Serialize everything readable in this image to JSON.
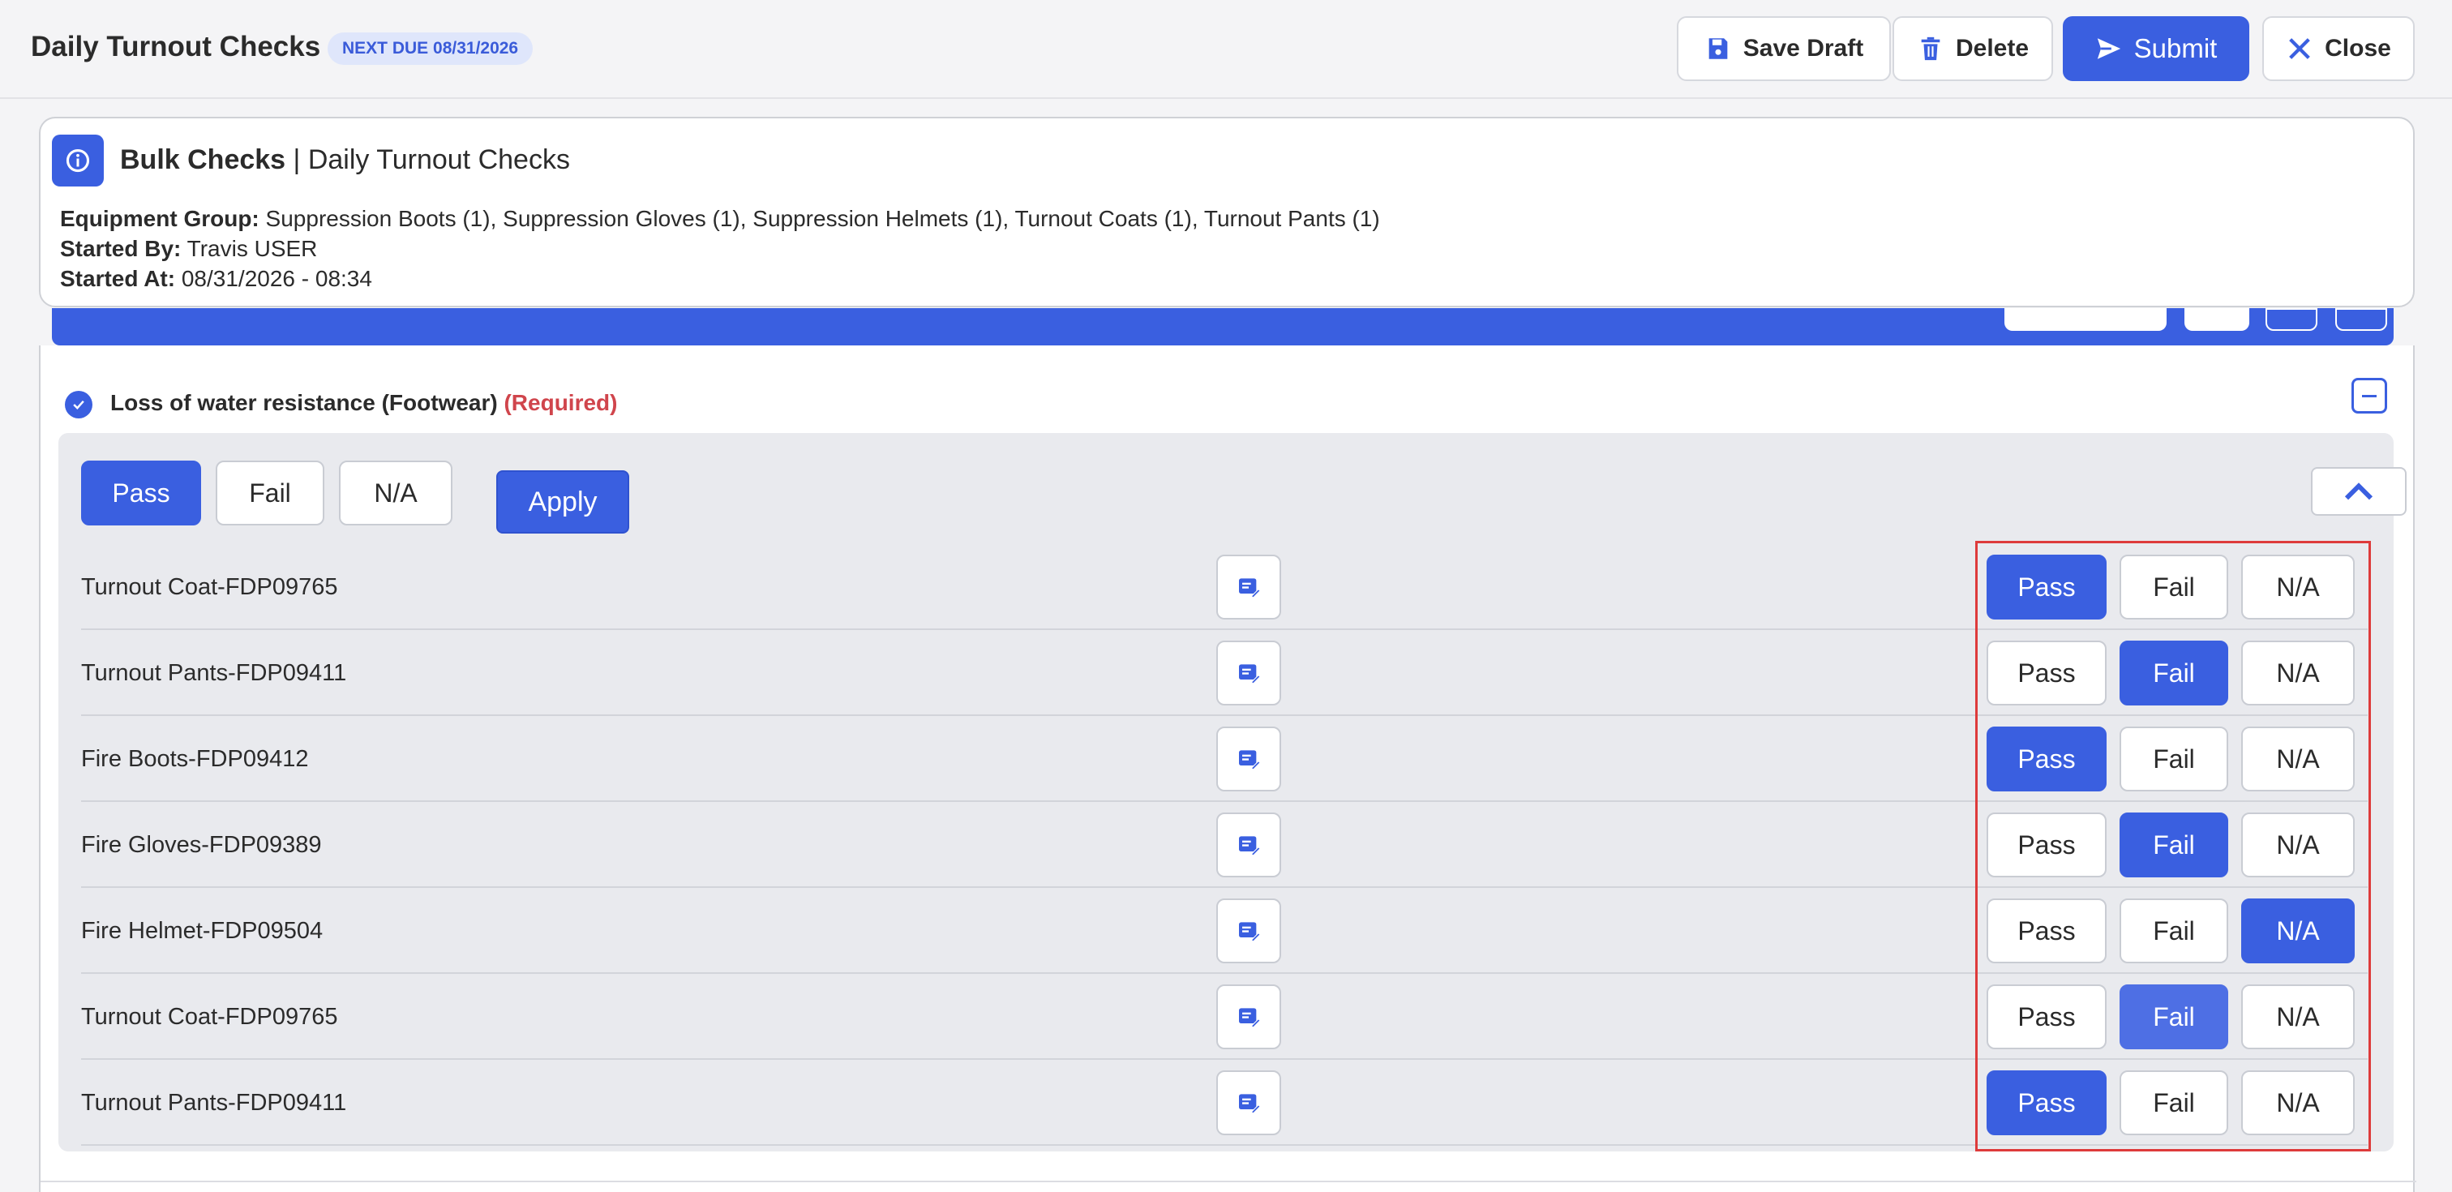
{
  "header": {
    "title": "Daily Turnout Checks",
    "due_badge": "NEXT DUE 08/31/2026",
    "buttons": {
      "save_draft": "Save Draft",
      "delete": "Delete",
      "submit": "Submit",
      "close": "Close"
    }
  },
  "info": {
    "title_bold": "Bulk Checks",
    "title_rest": " | Daily Turnout Checks",
    "equipment_label": "Equipment Group:",
    "equipment_value": " Suppression Boots (1), Suppression Gloves (1), Suppression Helmets (1), Turnout Coats (1), Turnout Pants (1)",
    "started_by_label": "Started By:",
    "started_by_value": " Travis USER",
    "started_at_label": "Started At:",
    "started_at_value": " 08/31/2026 - 08:34"
  },
  "question": {
    "text": "Loss of water resistance (Footwear)",
    "required": "(Required)"
  },
  "bulk": {
    "pass": "Pass",
    "fail": "Fail",
    "na": "N/A",
    "selected": "Pass",
    "apply": "Apply"
  },
  "rows": [
    {
      "label": "Turnout Coat-FDP09765",
      "selected": "Pass"
    },
    {
      "label": "Turnout Pants-FDP09411",
      "selected": "Fail"
    },
    {
      "label": "Fire Boots-FDP09412",
      "selected": "Pass"
    },
    {
      "label": "Fire Gloves-FDP09389",
      "selected": "Fail"
    },
    {
      "label": "Fire Helmet-FDP09504",
      "selected": "N/A"
    },
    {
      "label": "Turnout Coat-FDP09765",
      "selected": "Fail"
    },
    {
      "label": "Turnout Pants-FDP09411",
      "selected": "Pass"
    }
  ],
  "options": {
    "pass": "Pass",
    "fail": "Fail",
    "na": "N/A"
  },
  "colors": {
    "accent": "#3a5fe0",
    "required": "#d0454c",
    "highlight": "#de3b3b"
  }
}
